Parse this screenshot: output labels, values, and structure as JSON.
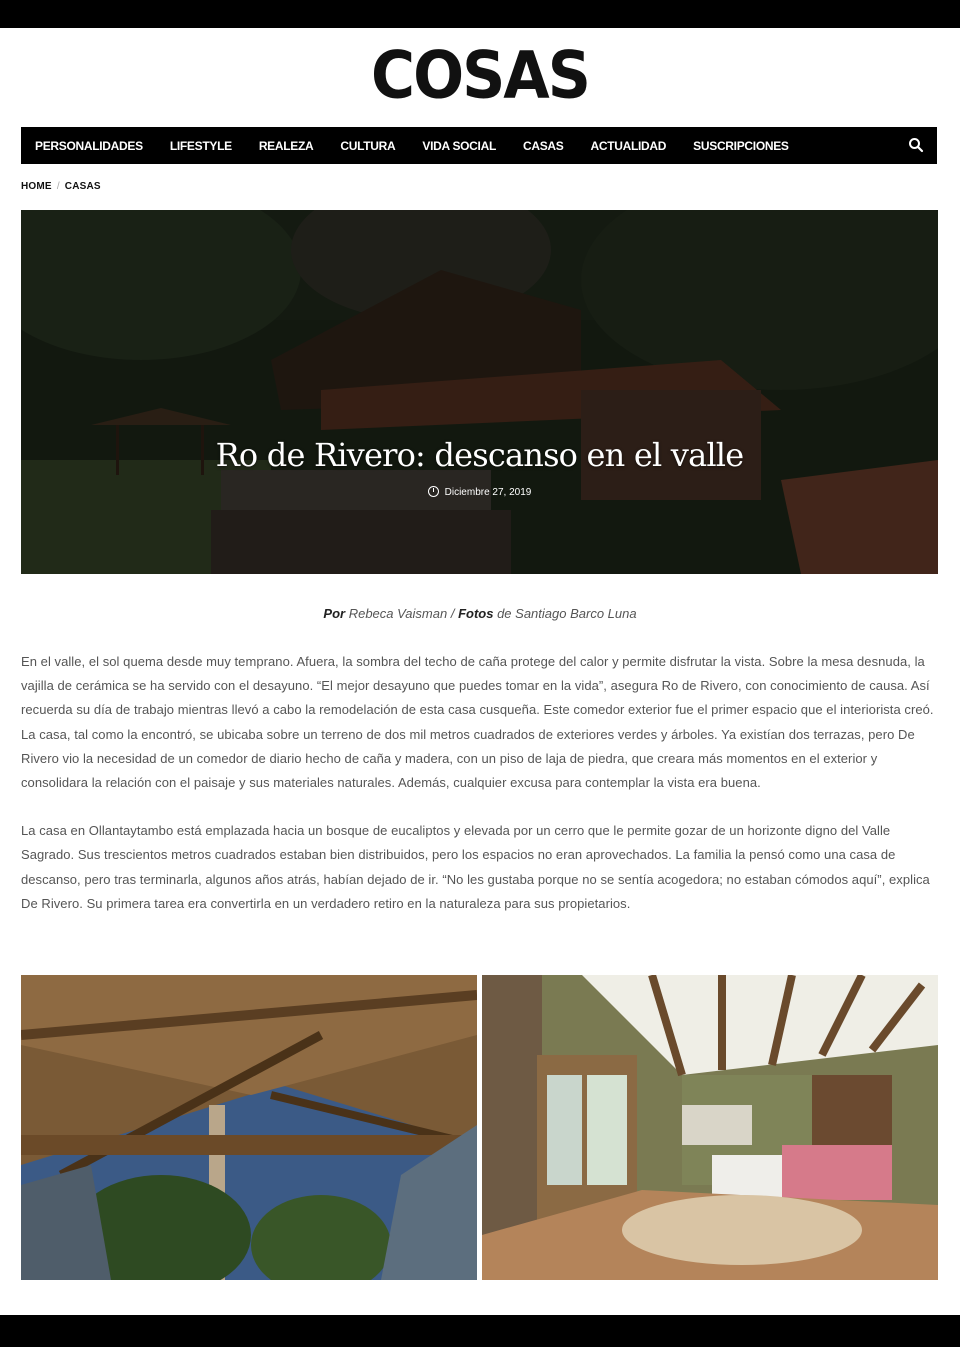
{
  "site": {
    "logo": "COSAS"
  },
  "nav": {
    "items": [
      "PERSONALIDADES",
      "LIFESTYLE",
      "REALEZA",
      "CULTURA",
      "VIDA SOCIAL",
      "CASAS",
      "ACTUALIDAD",
      "SUSCRIPCIONES"
    ],
    "search_icon": "search-icon"
  },
  "breadcrumb": {
    "home": "HOME",
    "section": "CASAS"
  },
  "hero": {
    "title": "Ro de Rivero: descanso en el valle",
    "date": "Diciembre 27, 2019"
  },
  "byline": {
    "by_label": "Por",
    "author": "Rebeca Vaisman",
    "photos_label": "Fotos",
    "photos_by": "de Santiago Barco Luna"
  },
  "article": {
    "paragraphs": [
      "En el valle, el sol quema desde muy temprano. Afuera, la sombra del techo de caña protege del calor y permite disfrutar la vista. Sobre la mesa desnuda, la vajilla de cerámica se ha servido con el desayuno. “El mejor desayuno que puedes tomar en la vida”, asegura Ro de Rivero, con conocimiento de causa. Así recuerda su día de trabajo mientras llevó a cabo la remodelación de esta casa cusqueña. Este comedor exterior fue el primer espacio que el interiorista creó. La casa, tal como la encontró, se ubicaba sobre un terreno de dos mil metros cuadrados de exteriores verdes y árboles. Ya existían dos terrazas, pero De Rivero vio la necesidad de un comedor de diario hecho de caña y madera, con un piso de laja de piedra, que creara más momentos en el exterior y consolidara la relación con el paisaje y sus materiales naturales. Además, cualquier excusa para contemplar la vista era buena.",
      "La casa en Ollantaytambo está emplazada hacia un bosque de eucaliptos y elevada por un cerro que le permite gozar de un horizonte digno del Valle Sagrado. Sus trescientos metros cuadrados estaban bien distribuidos, pero los espacios no eran aprovechados. La familia la pensó como una casa de descanso, pero tras terminarla, algunos años atrás, habían dejado de ir. “No les gustaba porque no se sentía acogedora; no estaban cómodos aquí”, explica De Rivero. Su primera tarea era convertirla en un verdadero retiro en la naturaleza para sus propietarios."
    ]
  }
}
